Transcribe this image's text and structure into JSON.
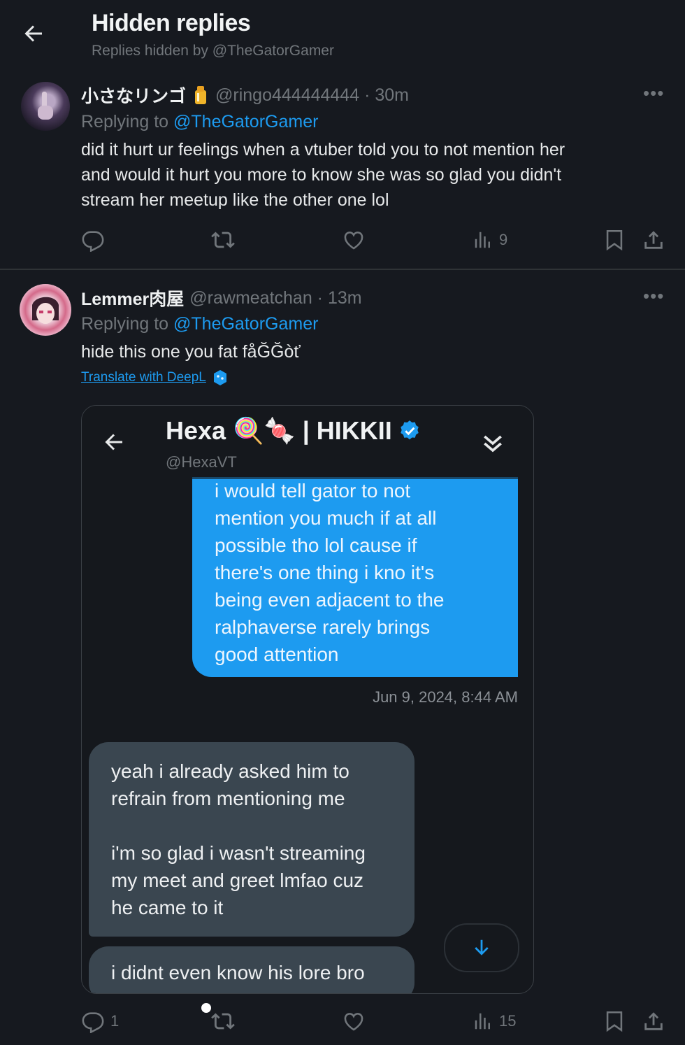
{
  "header": {
    "title": "Hidden replies",
    "subtitle": "Replies hidden by @TheGatorGamer"
  },
  "tweets": [
    {
      "name": "小さなリンゴ",
      "handle": "@ringo444444444 · 30m",
      "replying_prefix": "Replying to ",
      "replying_to": "@TheGatorGamer",
      "text_lines": [
        "did it hurt ur feelings when a vtuber told you to not mention her",
        "and would it hurt you more to know she was so glad you didn't",
        "stream her meetup like the other one lol"
      ],
      "views": "9"
    },
    {
      "name": "Lemmer肉屋",
      "handle": "@rawmeatchan · 13m",
      "replying_prefix": "Replying to ",
      "replying_to": "@TheGatorGamer",
      "text": "hide this one you fat fåĞĞòť",
      "translate": "Translate with DeepL",
      "replies": "1",
      "views": "15"
    }
  ],
  "embedded_dm": {
    "title": "Hexa 🍭🍬 | HIKKII",
    "handle": "@HexaVT",
    "sent_lines": [
      "i would tell gator to not",
      "mention you much if at all",
      "possible tho lol cause if",
      "there's one thing i kno it's",
      "being even adjacent to the",
      "ralphaverse rarely brings",
      "good attention"
    ],
    "timestamp": "Jun 9, 2024, 8:44 AM",
    "received_lines_a": [
      "yeah i already asked him to",
      "refrain from mentioning me"
    ],
    "received_lines_b": [
      "i'm so glad i wasn't streaming",
      "my meet and greet lmfao cuz",
      "he came to it"
    ],
    "received2": "i didnt even know his lore bro"
  },
  "colors": {
    "background": "#16191f",
    "accent": "#1d9bf0",
    "muted": "#71767b",
    "sent_bubble": "#1d9bf0",
    "received_bubble": "#3a4650"
  },
  "icons": [
    "back-arrow-icon",
    "more-icon",
    "reply-icon",
    "retweet-icon",
    "like-icon",
    "views-icon",
    "bookmark-icon",
    "share-icon",
    "verified-icon",
    "chevrons-down-icon",
    "arrow-down-icon",
    "deepl-icon"
  ]
}
